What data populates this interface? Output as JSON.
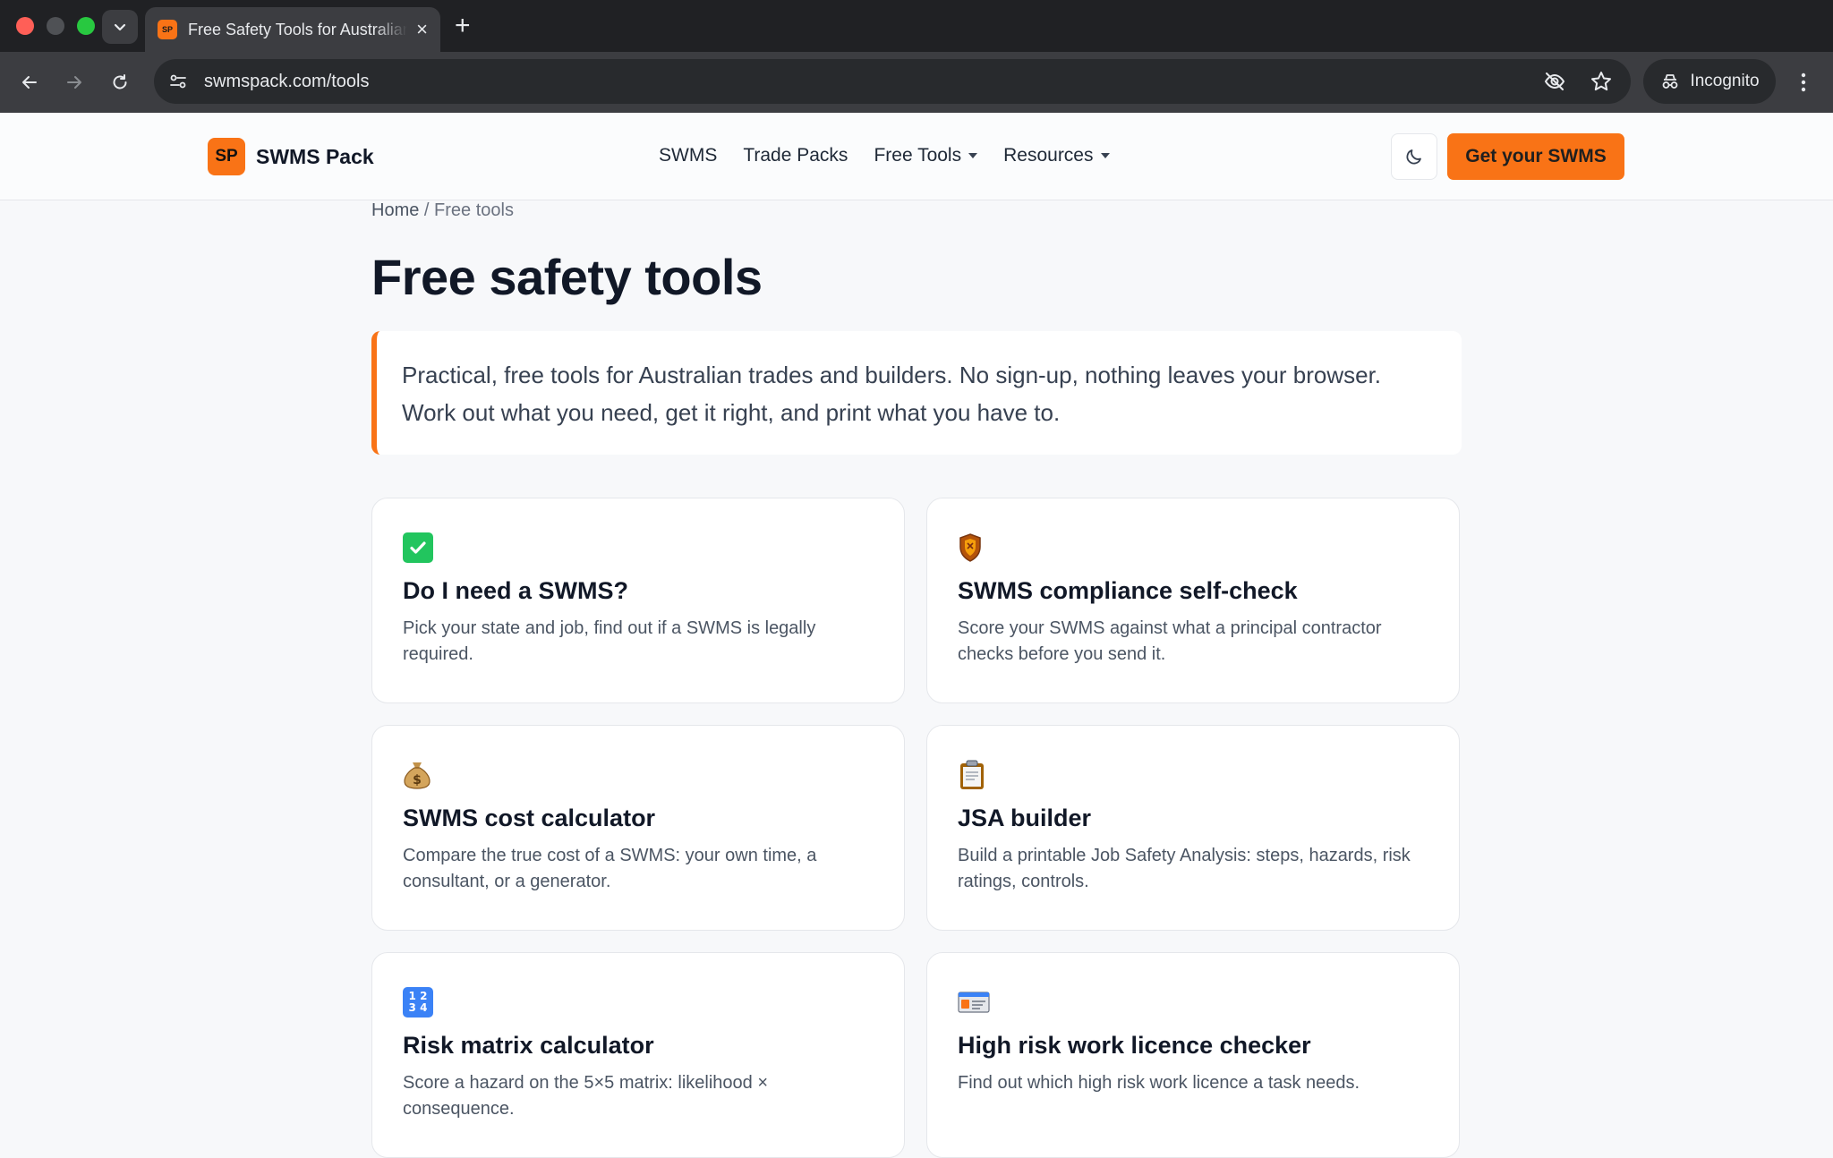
{
  "browser": {
    "tab_title": "Free Safety Tools for Australian Trades",
    "favicon_text": "SP",
    "url": "swmspack.com/tools",
    "incognito_label": "Incognito"
  },
  "header": {
    "logo_text": "SP",
    "brand_name": "SWMS Pack",
    "nav": [
      {
        "label": "SWMS"
      },
      {
        "label": "Trade Packs"
      },
      {
        "label": "Free Tools"
      },
      {
        "label": "Resources"
      }
    ],
    "cta_label": "Get your SWMS"
  },
  "breadcrumb": {
    "home": "Home",
    "separator": " / ",
    "current": "Free tools"
  },
  "page": {
    "title": "Free safety tools",
    "intro": "Practical, free tools for Australian trades and builders. No sign-up, nothing leaves your browser. Work out what you need, get it right, and print what you have to."
  },
  "tools": [
    {
      "icon": "check-mark-icon",
      "title": "Do I need a SWMS?",
      "desc": "Pick your state and job, find out if a SWMS is legally required."
    },
    {
      "icon": "shield-icon",
      "title": "SWMS compliance self-check",
      "desc": "Score your SWMS against what a principal contractor checks before you send it."
    },
    {
      "icon": "money-bag-icon",
      "title": "SWMS cost calculator",
      "desc": "Compare the true cost of a SWMS: your own time, a consultant, or a generator."
    },
    {
      "icon": "clipboard-icon",
      "title": "JSA builder",
      "desc": "Build a printable Job Safety Analysis: steps, hazards, risk ratings, controls."
    },
    {
      "icon": "numbers-icon",
      "title": "Risk matrix calculator",
      "desc": "Score a hazard on the 5×5 matrix: likelihood × consequence."
    },
    {
      "icon": "id-card-icon",
      "title": "High risk work licence checker",
      "desc": "Find out which high risk work licence a task needs."
    }
  ],
  "colors": {
    "accent": "#f97316",
    "title": "#111827",
    "text": "#4b5563"
  }
}
